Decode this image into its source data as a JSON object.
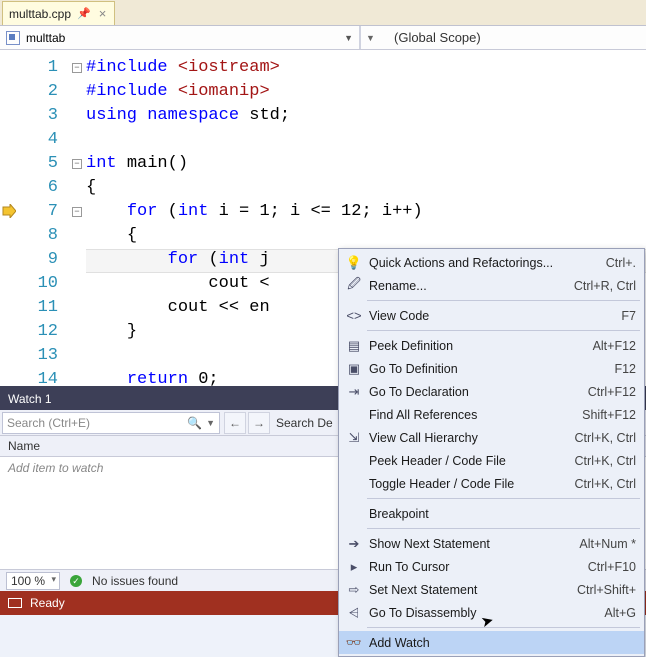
{
  "tab": {
    "filename": "multtab.cpp"
  },
  "scope": {
    "module": "multtab",
    "scope_label": "(Global Scope)"
  },
  "code": {
    "lines": [
      {
        "n": "1",
        "fold": "-",
        "html": "<span class='kw'>#include</span> <span class='str'>&lt;iostream&gt;</span>"
      },
      {
        "n": "2",
        "fold": "",
        "html": "<span class='kw'>#include</span> <span class='str'>&lt;iomanip&gt;</span>"
      },
      {
        "n": "3",
        "fold": "",
        "html": "<span class='kw'>using</span> <span class='kw'>namespace</span> <span class='txt'>std;</span>"
      },
      {
        "n": "4",
        "fold": "",
        "html": ""
      },
      {
        "n": "5",
        "fold": "-",
        "html": "<span class='kw'>int</span> <span class='txt'>main()</span>"
      },
      {
        "n": "6",
        "fold": "",
        "html": "<span class='txt'>{</span>"
      },
      {
        "n": "7",
        "fold": "-",
        "html": "    <span class='kw'>for</span> <span class='txt'>(</span><span class='kw'>int</span> <span class='txt'>i = 1; i &lt;= 12; i++)</span>"
      },
      {
        "n": "8",
        "fold": "",
        "html": "    <span class='txt'>{</span>"
      },
      {
        "n": "9",
        "fold": "",
        "html": "        <span class='kw'>for</span> <span class='txt'>(</span><span class='kw'>int</span> <span class='txt'>j</span>"
      },
      {
        "n": "10",
        "fold": "",
        "html": "            <span class='txt'>cout &lt;</span>"
      },
      {
        "n": "11",
        "fold": "",
        "html": "        <span class='txt'>cout &lt;&lt; en</span>"
      },
      {
        "n": "12",
        "fold": "",
        "html": "    <span class='txt'>}</span>"
      },
      {
        "n": "13",
        "fold": "",
        "html": ""
      },
      {
        "n": "14",
        "fold": "",
        "html": "    <span class='kw'>return</span> <span class='txt'>0;</span>"
      }
    ]
  },
  "watch": {
    "title": "Watch 1",
    "search_placeholder": "Search (Ctrl+E)",
    "search_depth": "Search De",
    "header": "Name",
    "empty": "Add item to watch"
  },
  "status": {
    "zoom": "100 %",
    "issues": "No issues found"
  },
  "ready": {
    "label": "Ready"
  },
  "menu": {
    "items": [
      {
        "icon": "bulb",
        "label": "Quick Actions and Refactorings...",
        "short": "Ctrl+."
      },
      {
        "icon": "rename",
        "label": "Rename...",
        "short": "Ctrl+R, Ctrl"
      },
      {
        "sep": true
      },
      {
        "icon": "code",
        "label": "View Code",
        "short": "F7"
      },
      {
        "sep": true
      },
      {
        "icon": "peek",
        "label": "Peek Definition",
        "short": "Alt+F12"
      },
      {
        "icon": "goto",
        "label": "Go To Definition",
        "short": "F12"
      },
      {
        "icon": "decl",
        "label": "Go To Declaration",
        "short": "Ctrl+F12"
      },
      {
        "icon": "",
        "label": "Find All References",
        "short": "Shift+F12"
      },
      {
        "icon": "hier",
        "label": "View Call Hierarchy",
        "short": "Ctrl+K, Ctrl"
      },
      {
        "icon": "",
        "label": "Peek Header / Code File",
        "short": "Ctrl+K, Ctrl"
      },
      {
        "icon": "",
        "label": "Toggle Header / Code File",
        "short": "Ctrl+K, Ctrl"
      },
      {
        "sep": true
      },
      {
        "icon": "",
        "label": "Breakpoint",
        "short": ""
      },
      {
        "sep": true
      },
      {
        "icon": "next",
        "label": "Show Next Statement",
        "short": "Alt+Num *"
      },
      {
        "icon": "run",
        "label": "Run To Cursor",
        "short": "Ctrl+F10"
      },
      {
        "icon": "set",
        "label": "Set Next Statement",
        "short": "Ctrl+Shift+"
      },
      {
        "icon": "dis",
        "label": "Go To Disassembly",
        "short": "Alt+G"
      },
      {
        "sep": true
      },
      {
        "icon": "watch",
        "label": "Add Watch",
        "short": "",
        "sel": true
      }
    ]
  }
}
